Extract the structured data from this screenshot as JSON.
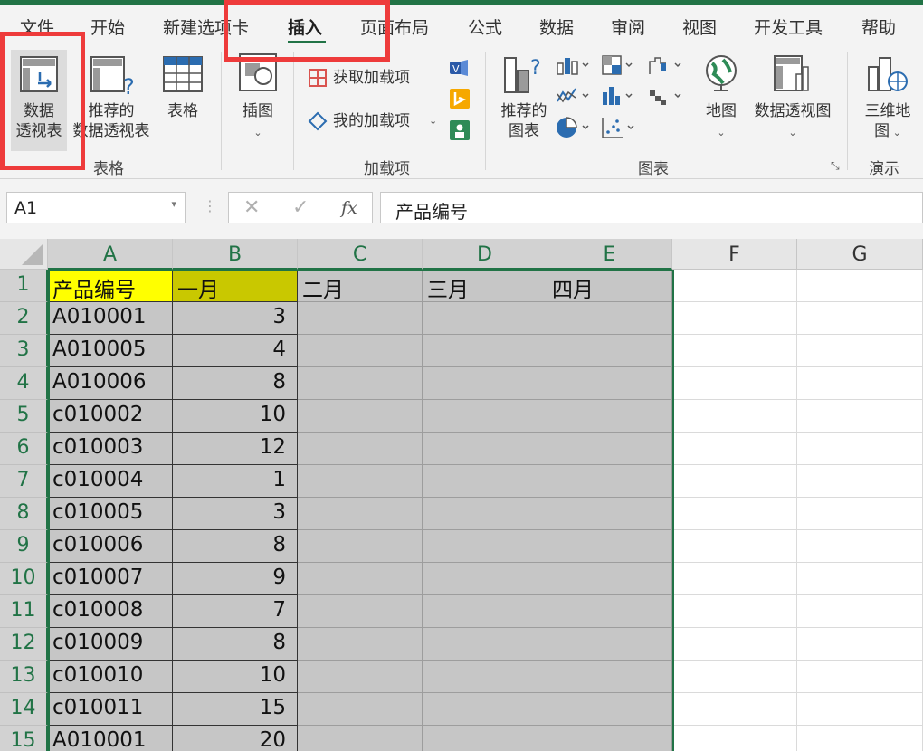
{
  "tabs": [
    "文件",
    "开始",
    "新建选项卡",
    "插入",
    "页面布局",
    "公式",
    "数据",
    "审阅",
    "视图",
    "开发工具",
    "帮助"
  ],
  "active_tab": "插入",
  "ribbon": {
    "tables": {
      "pivot_line1": "数据",
      "pivot_line2": "透视表",
      "recommended_line1": "推荐的",
      "recommended_line2": "数据透视表",
      "table": "表格",
      "group_label": "表格"
    },
    "illustrations": {
      "label": "插图"
    },
    "addins": {
      "get_addins": "获取加载项",
      "my_addins": "我的加载项",
      "group_label": "加载项"
    },
    "charts": {
      "recommended_line1": "推荐的",
      "recommended_line2": "图表",
      "map": "地图",
      "pivot_chart": "数据透视图",
      "group_label": "图表"
    },
    "tours": {
      "map3d_line1": "三维地",
      "map3d_line2": "图",
      "group_label": "演示"
    }
  },
  "formula_bar": {
    "name_box": "A1",
    "fx": "fx",
    "content": "产品编号"
  },
  "columns": [
    "A",
    "B",
    "C",
    "D",
    "E",
    "F",
    "G"
  ],
  "rows": [
    {
      "n": "1",
      "a": "产品编号",
      "b": "一月",
      "c": "二月",
      "d": "三月",
      "e": "四月"
    },
    {
      "n": "2",
      "a": "A010001",
      "b": "3",
      "c": "",
      "d": "",
      "e": ""
    },
    {
      "n": "3",
      "a": "A010005",
      "b": "4",
      "c": "",
      "d": "",
      "e": ""
    },
    {
      "n": "4",
      "a": "A010006",
      "b": "8",
      "c": "",
      "d": "",
      "e": ""
    },
    {
      "n": "5",
      "a": "c010002",
      "b": "10",
      "c": "",
      "d": "",
      "e": ""
    },
    {
      "n": "6",
      "a": "c010003",
      "b": "12",
      "c": "",
      "d": "",
      "e": ""
    },
    {
      "n": "7",
      "a": "c010004",
      "b": "1",
      "c": "",
      "d": "",
      "e": ""
    },
    {
      "n": "8",
      "a": "c010005",
      "b": "3",
      "c": "",
      "d": "",
      "e": ""
    },
    {
      "n": "9",
      "a": "c010006",
      "b": "8",
      "c": "",
      "d": "",
      "e": ""
    },
    {
      "n": "10",
      "a": "c010007",
      "b": "9",
      "c": "",
      "d": "",
      "e": ""
    },
    {
      "n": "11",
      "a": "c010008",
      "b": "7",
      "c": "",
      "d": "",
      "e": ""
    },
    {
      "n": "12",
      "a": "c010009",
      "b": "8",
      "c": "",
      "d": "",
      "e": ""
    },
    {
      "n": "13",
      "a": "c010010",
      "b": "10",
      "c": "",
      "d": "",
      "e": ""
    },
    {
      "n": "14",
      "a": "c010011",
      "b": "15",
      "c": "",
      "d": "",
      "e": ""
    },
    {
      "n": "15",
      "a": "A010001",
      "b": "20",
      "c": "",
      "d": "",
      "e": ""
    }
  ],
  "colors": {
    "accent": "#217346",
    "header_yellow": "#ffff00",
    "header_olive": "#c9c800",
    "highlight_red": "#ee3b3b"
  }
}
